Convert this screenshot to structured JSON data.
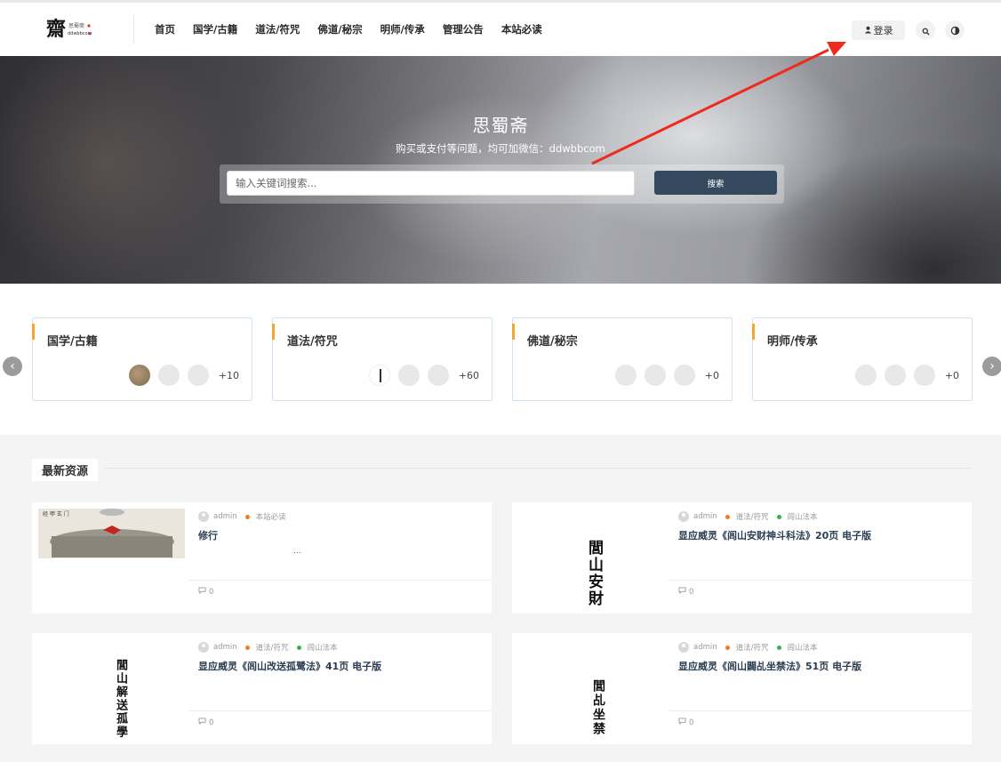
{
  "header": {
    "logo_alt": "思蜀斋",
    "nav": [
      "首页",
      "国学/古籍",
      "道法/符咒",
      "佛道/秘宗",
      "明师/传承",
      "管理公告",
      "本站必读"
    ],
    "login_label": "登录",
    "search_icon": "search-icon",
    "theme_icon": "theme-toggle-icon"
  },
  "hero": {
    "title": "思蜀斋",
    "subtitle": "购买或支付等问题，均可加微信：ddwbbcom",
    "search_placeholder": "输入关键词搜索...",
    "search_button": "搜索"
  },
  "categories": [
    {
      "name": "国学/古籍",
      "more": "+10"
    },
    {
      "name": "道法/符咒",
      "more": "+60"
    },
    {
      "name": "佛道/秘宗",
      "more": "+0"
    },
    {
      "name": "明师/传承",
      "more": "+0"
    }
  ],
  "latest": {
    "section_title": "最新资源",
    "posts": [
      {
        "author": "admin",
        "tags": [
          "本站必读"
        ],
        "title": "修行",
        "excerpt": "...",
        "comments": "0",
        "thumb_text": "经 咿 玄 门"
      },
      {
        "author": "admin",
        "tags": [
          "道法/符咒",
          "闾山法本"
        ],
        "title": "显应威灵《闾山安财神斗科法》20页 电子版",
        "comments": "0",
        "thumb_text": "閭山安財"
      },
      {
        "author": "admin",
        "tags": [
          "道法/符咒",
          "闾山法本"
        ],
        "title": "显应威灵《闾山改送孤鹭法》41页 电子版",
        "comments": "0",
        "thumb_text": "閭山解送孤學"
      },
      {
        "author": "admin",
        "tags": [
          "道法/符咒",
          "闾山法本"
        ],
        "title": "显应威灵《闾山闢乩坐禁法》51页 电子版",
        "comments": "0",
        "thumb_text": "閭乩坐禁"
      }
    ]
  }
}
